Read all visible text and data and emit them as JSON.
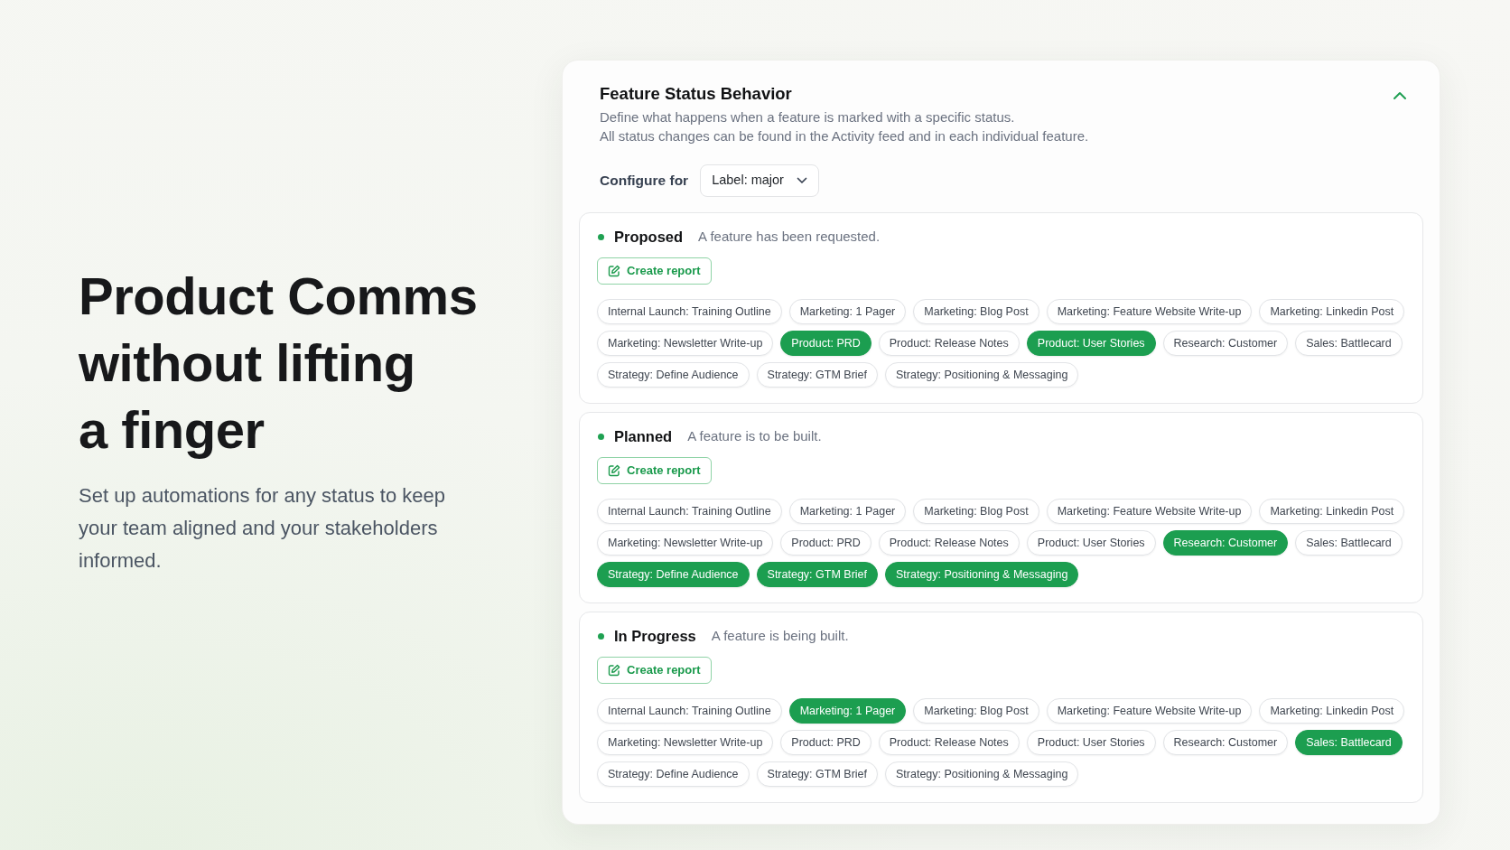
{
  "hero": {
    "heading_lines": [
      "Product Comms",
      "without lifting",
      "a finger"
    ],
    "description": "Set up automations for any status to keep your team aligned and your stakeholders informed."
  },
  "panel": {
    "title": "Feature Status Behavior",
    "expanded": true,
    "description_lines": [
      "Define what happens when a feature is marked with a specific status.",
      "All status changes can be found in the Activity feed and in each individual feature."
    ],
    "configure": {
      "label": "Configure for",
      "value": "Label: major"
    },
    "statuses": [
      {
        "name": "Proposed",
        "description": "A feature has been requested.",
        "action": "Create report",
        "tags": [
          {
            "label": "Internal Launch: Training Outline",
            "selected": false
          },
          {
            "label": "Marketing: 1 Pager",
            "selected": false
          },
          {
            "label": "Marketing: Blog Post",
            "selected": false
          },
          {
            "label": "Marketing: Feature Website Write-up",
            "selected": false
          },
          {
            "label": "Marketing: Linkedin Post",
            "selected": false
          },
          {
            "label": "Marketing: Newsletter Write-up",
            "selected": false
          },
          {
            "label": "Product: PRD",
            "selected": true
          },
          {
            "label": "Product: Release Notes",
            "selected": false
          },
          {
            "label": "Product: User Stories",
            "selected": true
          },
          {
            "label": "Research: Customer",
            "selected": false
          },
          {
            "label": "Sales: Battlecard",
            "selected": false
          },
          {
            "label": "Strategy: Define Audience",
            "selected": false
          },
          {
            "label": "Strategy: GTM Brief",
            "selected": false
          },
          {
            "label": "Strategy: Positioning & Messaging",
            "selected": false
          }
        ]
      },
      {
        "name": "Planned",
        "description": "A feature is to be built.",
        "action": "Create report",
        "tags": [
          {
            "label": "Internal Launch: Training Outline",
            "selected": false
          },
          {
            "label": "Marketing: 1 Pager",
            "selected": false
          },
          {
            "label": "Marketing: Blog Post",
            "selected": false
          },
          {
            "label": "Marketing: Feature Website Write-up",
            "selected": false
          },
          {
            "label": "Marketing: Linkedin Post",
            "selected": false
          },
          {
            "label": "Marketing: Newsletter Write-up",
            "selected": false
          },
          {
            "label": "Product: PRD",
            "selected": false
          },
          {
            "label": "Product: Release Notes",
            "selected": false
          },
          {
            "label": "Product: User Stories",
            "selected": false
          },
          {
            "label": "Research: Customer",
            "selected": true
          },
          {
            "label": "Sales: Battlecard",
            "selected": false
          },
          {
            "label": "Strategy: Define Audience",
            "selected": true
          },
          {
            "label": "Strategy: GTM Brief",
            "selected": true
          },
          {
            "label": "Strategy: Positioning & Messaging",
            "selected": true
          }
        ]
      },
      {
        "name": "In Progress",
        "description": "A feature is being built.",
        "action": "Create report",
        "tags": [
          {
            "label": "Internal Launch: Training Outline",
            "selected": false
          },
          {
            "label": "Marketing: 1 Pager",
            "selected": true
          },
          {
            "label": "Marketing: Blog Post",
            "selected": false
          },
          {
            "label": "Marketing: Feature Website Write-up",
            "selected": false
          },
          {
            "label": "Marketing: Linkedin Post",
            "selected": false
          },
          {
            "label": "Marketing: Newsletter Write-up",
            "selected": false
          },
          {
            "label": "Product: PRD",
            "selected": false
          },
          {
            "label": "Product: Release Notes",
            "selected": false
          },
          {
            "label": "Product: User Stories",
            "selected": false
          },
          {
            "label": "Research: Customer",
            "selected": false
          },
          {
            "label": "Sales: Battlecard",
            "selected": true
          },
          {
            "label": "Strategy: Define Audience",
            "selected": false
          },
          {
            "label": "Strategy: GTM Brief",
            "selected": false
          },
          {
            "label": "Strategy: Positioning & Messaging",
            "selected": false
          }
        ]
      }
    ]
  }
}
